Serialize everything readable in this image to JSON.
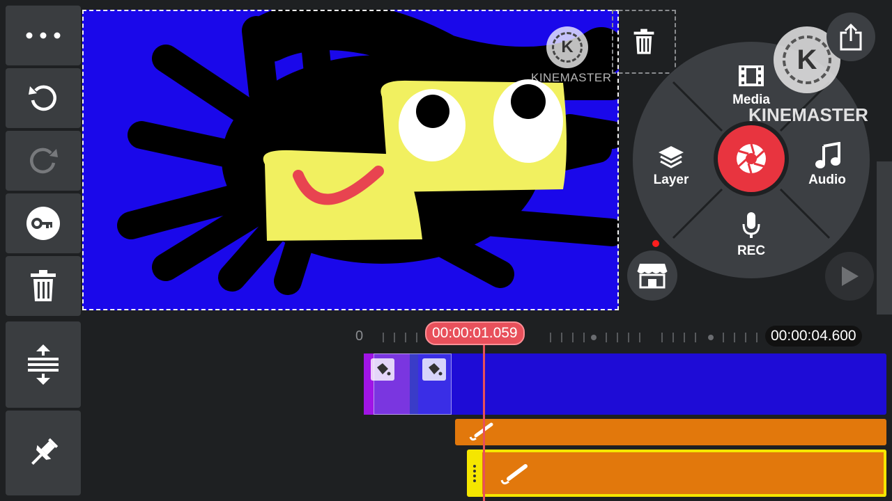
{
  "app": {
    "name": "KineMaster"
  },
  "watermarks": [
    {
      "logo_letter": "K",
      "text": "KINEMASTER"
    },
    {
      "logo_letter": "K",
      "text": "KINEMASTER"
    }
  ],
  "left_toolbar": {
    "tools": [
      {
        "name": "more-icon"
      },
      {
        "name": "undo-icon"
      },
      {
        "name": "redo-icon",
        "disabled": true
      },
      {
        "name": "keyframe-icon"
      },
      {
        "name": "trash-icon"
      },
      {
        "name": "expand-timeline-icon"
      },
      {
        "name": "pin-icon"
      }
    ]
  },
  "wheel": {
    "media_label": "Media",
    "layer_label": "Layer",
    "audio_label": "Audio",
    "rec_label": "REC",
    "center_color": "#e8343f"
  },
  "top_right": {
    "export_icon": "share-icon",
    "delete_icon": "trash-icon"
  },
  "store": {
    "icon": "store-icon"
  },
  "play": {
    "icon": "play-icon"
  },
  "timeline": {
    "start_label": "0",
    "playhead_time": "00:00:01.059",
    "total_time": "00:00:04.600",
    "playhead_color": "#e8505b",
    "tracks": {
      "main_color": "#1e0cd6",
      "layer_color": "#e2780c",
      "selected_outline_color": "#f5e600"
    }
  },
  "colors": {
    "background": "#1e2022",
    "preview_bg": "#1a08ea",
    "character_yellow": "#f1f060",
    "smile_red": "#e84450"
  }
}
